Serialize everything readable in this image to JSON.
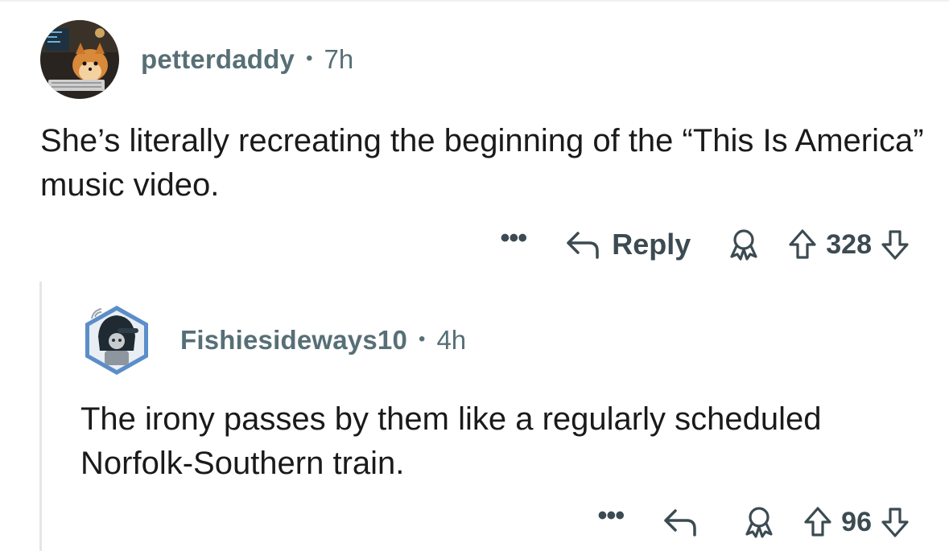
{
  "comments": [
    {
      "author": "petterdaddy",
      "separator": "•",
      "age": "7h",
      "body": "She’s literally recreating the beginning of the “This Is America” music video.",
      "actions": {
        "more_label": "•••",
        "reply_label": "Reply",
        "vote_count": "328"
      },
      "avatar_icon": "pomeranian-dog-avatar"
    },
    {
      "author": "Fishiesideways10",
      "separator": "•",
      "age": "4h",
      "body": "The irony passes by them like a regularly scheduled Norfolk-Southern train.",
      "actions": {
        "more_label": "•••",
        "vote_count": "96"
      },
      "avatar_icon": "hooded-character-avatar"
    }
  ],
  "colors": {
    "meta_text": "#576f76",
    "body_text": "#1a1a1b",
    "action_text": "#3c4b52",
    "thread_line": "#e4e6e8",
    "avatar2_ring": "#5b8ec9"
  },
  "icons": {
    "reply": "reply-arrow-icon",
    "award": "award-icon",
    "upvote": "upvote-arrow-icon",
    "downvote": "downvote-arrow-icon",
    "more": "more-options-icon"
  }
}
